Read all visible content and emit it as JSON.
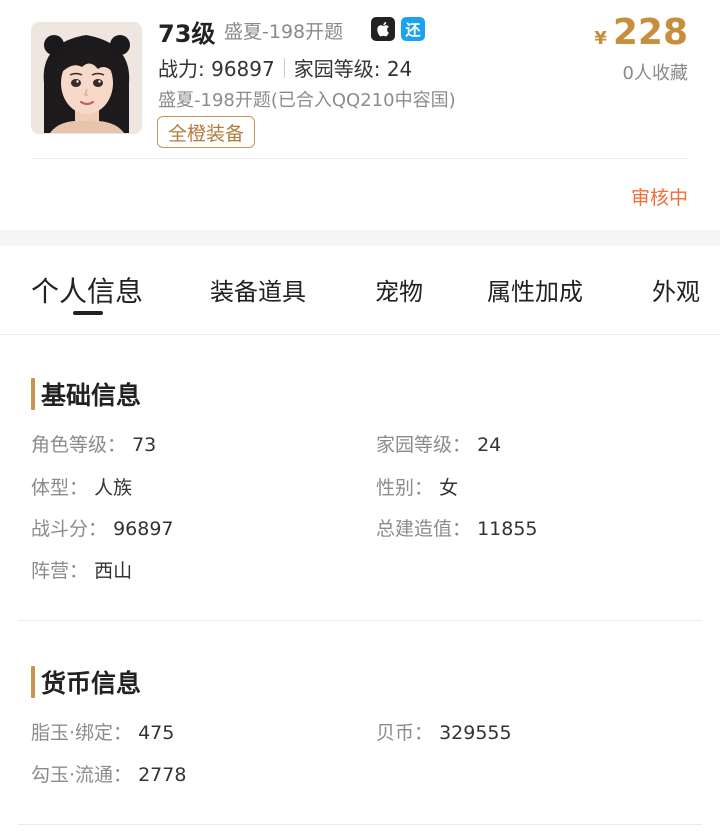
{
  "listing": {
    "level": "73级",
    "server": "盛夏-198开题",
    "platform_icon": "apple-icon",
    "return_badge": "还",
    "power_label": "战力: 96897",
    "home_level_label": "家园等级: 24",
    "merge_info": "盛夏-198开题(已合入QQ210中容国)",
    "tag": "全橙装备",
    "currency_symbol": "¥",
    "price": "228",
    "favorites": "0人收藏",
    "status": "审核中",
    "colors": {
      "price": "#c58f3e",
      "status": "#ef6e3a",
      "tag_border": "#c79656",
      "return_badge": "#1aa2f0"
    }
  },
  "tabs": [
    {
      "label": "个人信息",
      "active": true
    },
    {
      "label": "装备道具"
    },
    {
      "label": "宠物"
    },
    {
      "label": "属性加成"
    },
    {
      "label": "外观"
    }
  ],
  "basic_info": {
    "title": "基础信息",
    "fields": [
      {
        "label": "角色等级：",
        "value": "73"
      },
      {
        "label": "家园等级：",
        "value": "24"
      },
      {
        "label": "体型：",
        "value": "人族"
      },
      {
        "label": "性别：",
        "value": "女"
      },
      {
        "label": "战斗分：",
        "value": "96897"
      },
      {
        "label": "总建造值：",
        "value": "11855"
      },
      {
        "label": "阵营：",
        "value": "西山"
      }
    ]
  },
  "currency_info": {
    "title": "货币信息",
    "fields": [
      {
        "label": "脂玉·绑定：",
        "value": "475"
      },
      {
        "label": "贝币：",
        "value": "329555"
      },
      {
        "label": "勾玉·流通：",
        "value": "2778"
      }
    ]
  }
}
